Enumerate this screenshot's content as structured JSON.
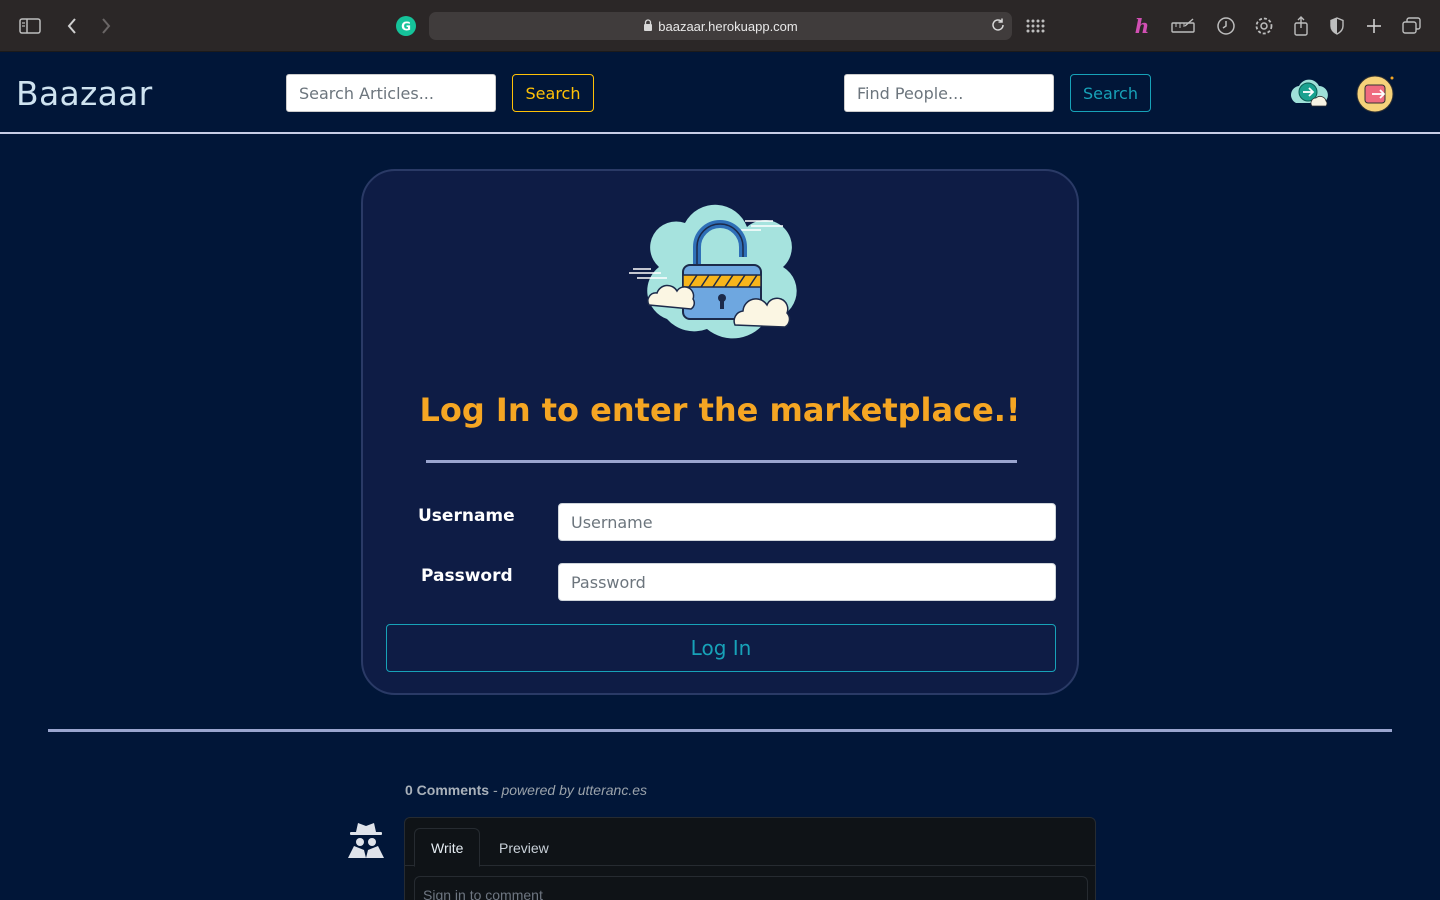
{
  "browser": {
    "url": "baazaar.herokuapp.com",
    "icons": [
      "sidebar-icon",
      "back-icon",
      "forward-icon",
      "grammarly-icon",
      "lock-icon",
      "reload-icon",
      "grid-icon",
      "honey-icon",
      "ruler-icon",
      "history-icon",
      "gear-icon",
      "share-icon",
      "shield-icon",
      "new-tab-icon",
      "tabs-overview-icon"
    ]
  },
  "nav": {
    "brand": "Baazaar",
    "article_search_placeholder": "Search Articles...",
    "article_search_button": "Search",
    "people_search_placeholder": "Find People...",
    "people_search_button": "Search",
    "icons": [
      "login-icon",
      "logout-icon"
    ]
  },
  "login": {
    "title": "Log In to enter the marketplace.!",
    "username_label": "Username",
    "username_placeholder": "Username",
    "password_label": "Password",
    "password_placeholder": "Password",
    "submit_label": "Log In",
    "illustration": "unlocked-padlock-cloud-icon"
  },
  "comments": {
    "count_label": "0 Comments",
    "powered_by": "- powered by utteranc.es",
    "tabs": [
      "Write",
      "Preview"
    ],
    "placeholder": "Sign in to comment"
  },
  "colors": {
    "page_bg": "#011638",
    "card_bg": "#0e1c45",
    "title": "#f5a623",
    "warning": "#ffc107",
    "info": "#17a2b8"
  }
}
